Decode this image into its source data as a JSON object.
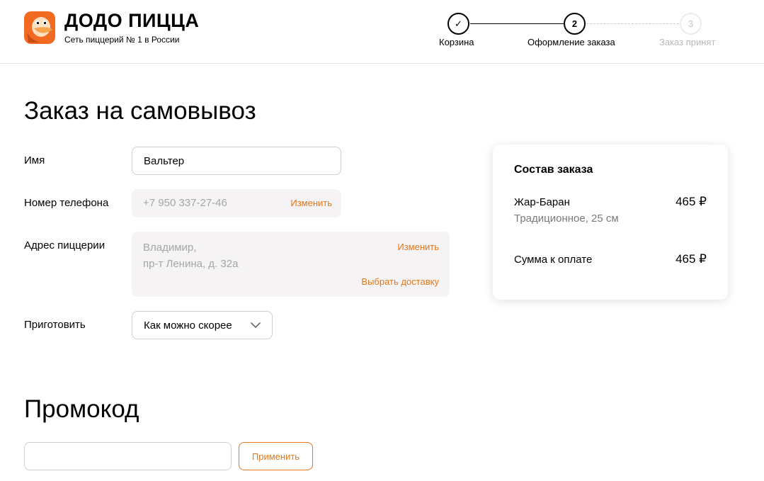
{
  "header": {
    "brand_title": "ДОДО ПИЦЦА",
    "brand_subtitle": "Сеть пиццерий № 1 в России",
    "logo_icon": "dodo-bird-logo",
    "steps": [
      {
        "number": "✓",
        "label": "Корзина",
        "state": "done"
      },
      {
        "number": "2",
        "label": "Оформление заказа",
        "state": "current"
      },
      {
        "number": "3",
        "label": "Заказ принят",
        "state": "upcoming"
      }
    ]
  },
  "form": {
    "title": "Заказ на самовывоз",
    "name": {
      "label": "Имя",
      "value": "Вальтер"
    },
    "phone": {
      "label": "Номер телефона",
      "value": "+7 950 337-27-46",
      "change_link": "Изменить"
    },
    "address": {
      "label": "Адрес пиццерии",
      "line1": "Владимир,",
      "line2": "пр-т Ленина, д. 32а",
      "change_link": "Изменить",
      "delivery_link": "Выбрать доставку"
    },
    "prepare": {
      "label": "Приготовить",
      "selected": "Как можно скорее"
    }
  },
  "promo": {
    "title": "Промокод",
    "input_value": "",
    "apply_label": "Применить"
  },
  "order": {
    "title": "Состав заказа",
    "items": [
      {
        "name": "Жар-Баран",
        "description": "Традиционное, 25 см",
        "price": "465 ₽"
      }
    ],
    "total_label": "Сумма к оплате",
    "total_value": "465 ₽"
  },
  "colors": {
    "accent": "#e0781d",
    "field_bg": "#f5f3f3",
    "border": "#cfcfcf"
  }
}
